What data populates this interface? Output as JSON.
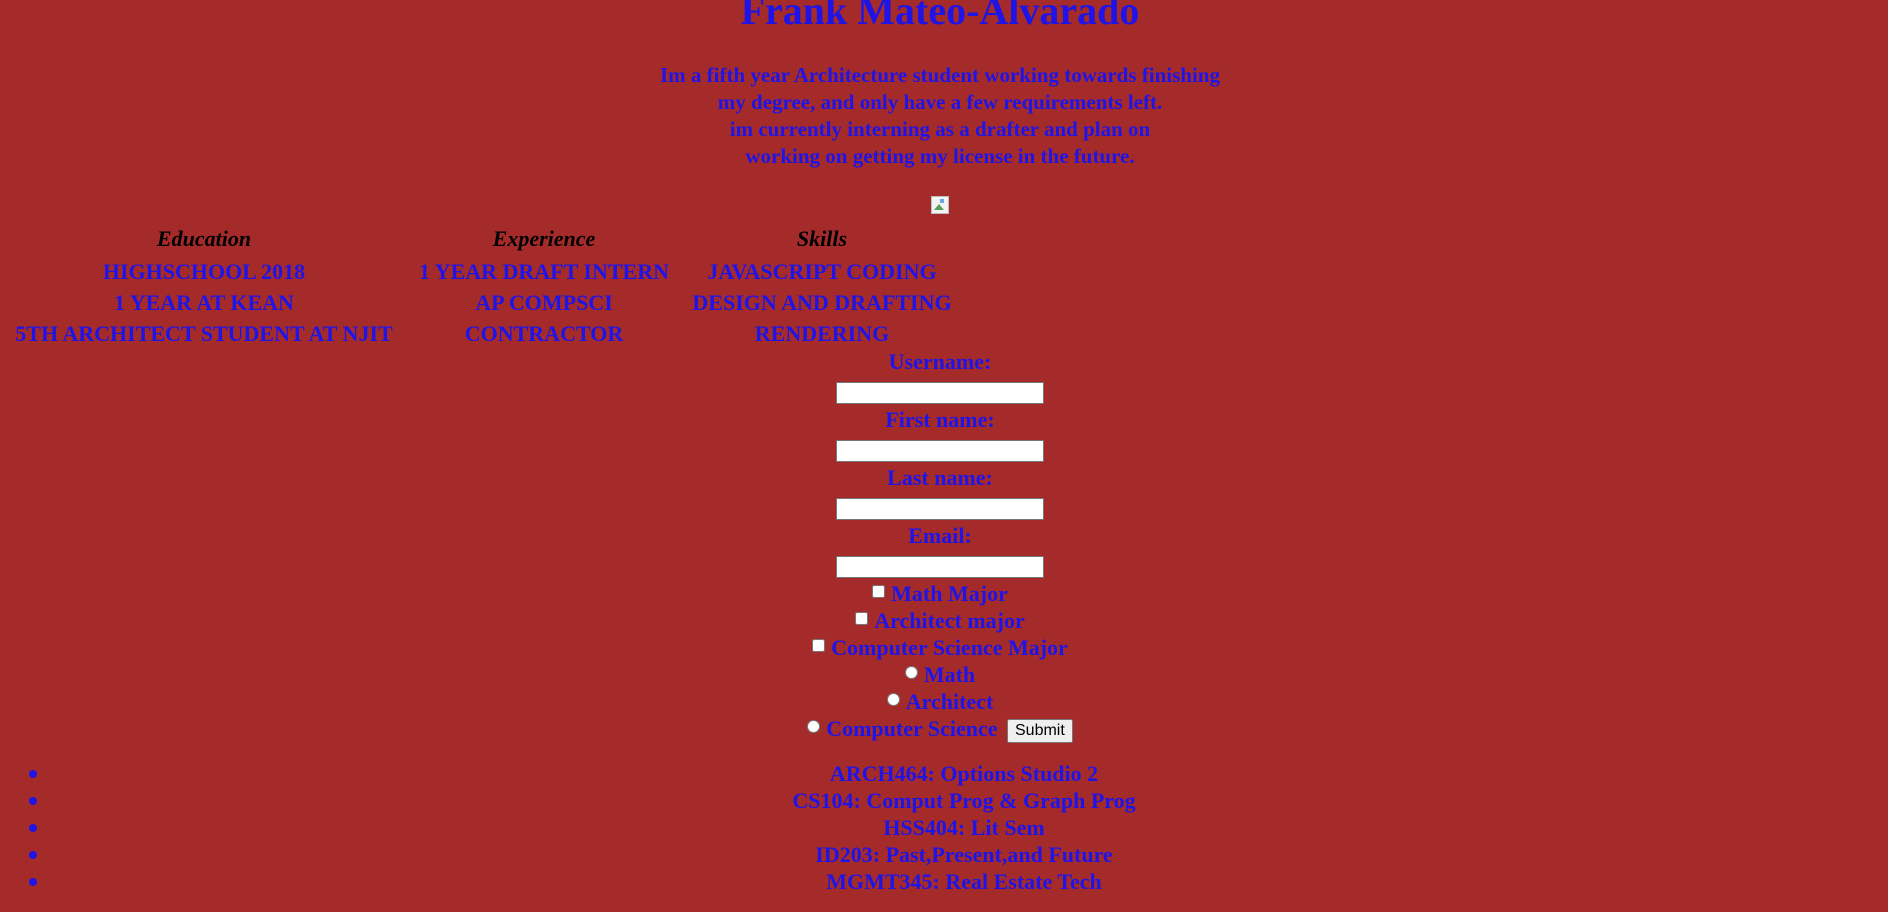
{
  "page": {
    "title": "Frank Mateo-Alvarado",
    "intro_lines": [
      "Im a fifth year Architecture student working towards finishing",
      "my degree, and only have a few requirements left.",
      "im currently interning as a drafter and plan on",
      "working on getting my license in the future."
    ],
    "profile_image_icon": "broken-image-icon"
  },
  "table": {
    "headers": [
      "Education",
      "Experience",
      "Skills"
    ],
    "rows": [
      [
        "HIGHSCHOOL 2018",
        "1 YEAR DRAFT INTERN",
        "JAVASCRIPT CODING"
      ],
      [
        "1 YEAR AT KEAN",
        "AP COMPSCI",
        "DESIGN AND DRAFTING"
      ],
      [
        "5TH ARCHITECT STUDENT AT NJIT",
        "CONTRACTOR",
        "RENDERING"
      ]
    ]
  },
  "form": {
    "username_label": "Username:",
    "username_value": "",
    "firstname_label": "First name:",
    "firstname_value": "",
    "lastname_label": "Last name:",
    "lastname_value": "",
    "email_label": "Email:",
    "email_value": "",
    "checkboxes": [
      {
        "label": "Math Major",
        "checked": false
      },
      {
        "label": "Architect major",
        "checked": false
      },
      {
        "label": "Computer Science Major",
        "checked": false
      }
    ],
    "radios": [
      {
        "label": "Math",
        "checked": false
      },
      {
        "label": "Architect",
        "checked": false
      },
      {
        "label": "Computer Science",
        "checked": false
      }
    ],
    "submit_label": "Submit"
  },
  "courses": [
    "ARCH464: Options Studio 2",
    "CS104: Comput Prog & Graph Prog",
    "HSS404: Lit Sem",
    "ID203: Past,Present,and Future",
    "MGMT345: Real Estate Tech"
  ],
  "colors": {
    "background": "#a52a2a",
    "text": "#1f14e8",
    "header_text": "#000000"
  }
}
